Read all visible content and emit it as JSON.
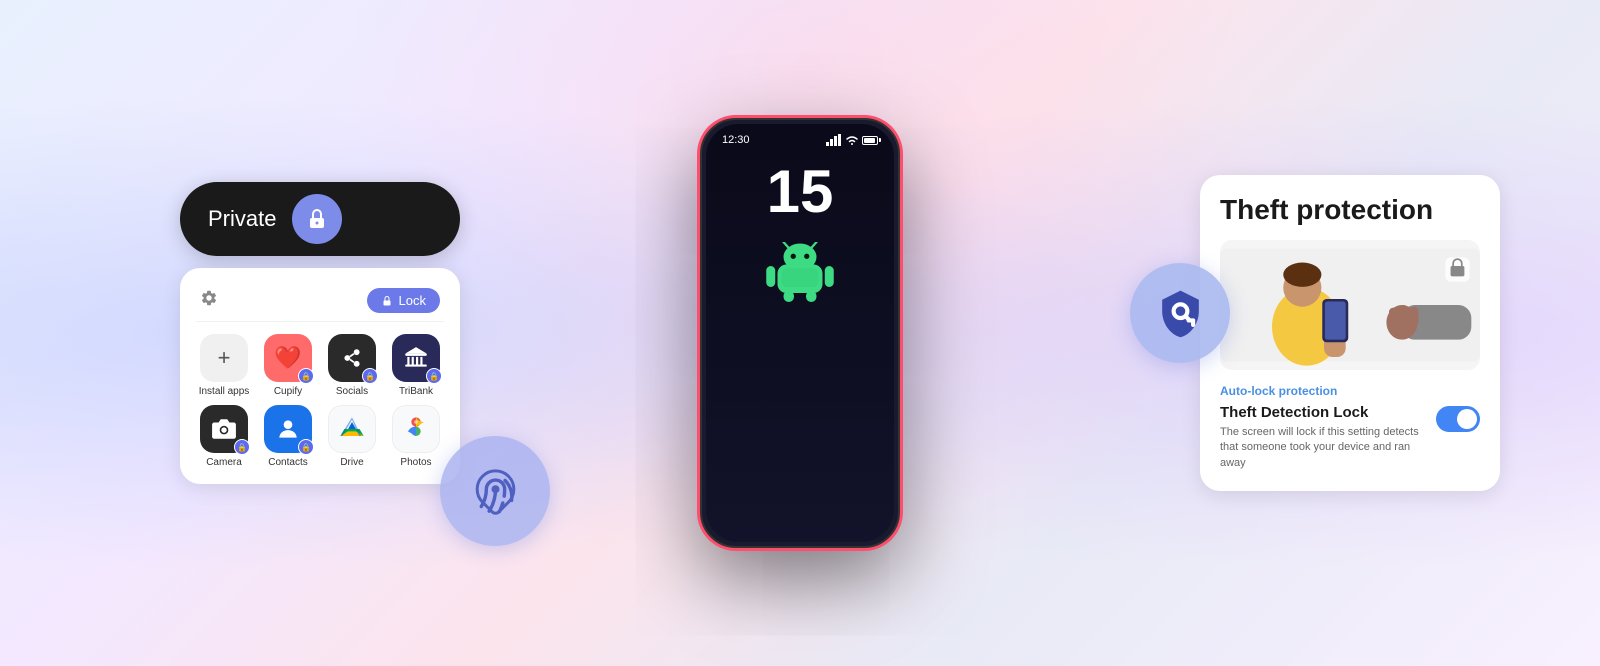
{
  "background": {
    "gradient_desc": "light purple-blue-pink gradient"
  },
  "phone": {
    "time": "12:30",
    "date": "15",
    "status_icons": [
      "signal",
      "wifi",
      "battery"
    ]
  },
  "private_space": {
    "label": "Private",
    "lock_button_label": "Lock",
    "apps": [
      {
        "name": "Install apps",
        "type": "install"
      },
      {
        "name": "Cupify",
        "type": "cupify"
      },
      {
        "name": "Socials",
        "type": "socials"
      },
      {
        "name": "TriBank",
        "type": "tribank"
      },
      {
        "name": "Camera",
        "type": "camera"
      },
      {
        "name": "Contacts",
        "type": "contacts"
      },
      {
        "name": "Drive",
        "type": "drive"
      },
      {
        "name": "Photos",
        "type": "photos"
      }
    ]
  },
  "theft_protection": {
    "title": "Theft protection",
    "auto_lock_label": "Auto-lock protection",
    "detection_title": "Theft Detection Lock",
    "detection_desc": "The screen will lock if this setting detects that someone took your device and ran away",
    "toggle_state": "on"
  },
  "fingerprint_bubble": {
    "icon": "fingerprint-icon"
  },
  "shield_bubble": {
    "icon": "shield-key-icon"
  }
}
